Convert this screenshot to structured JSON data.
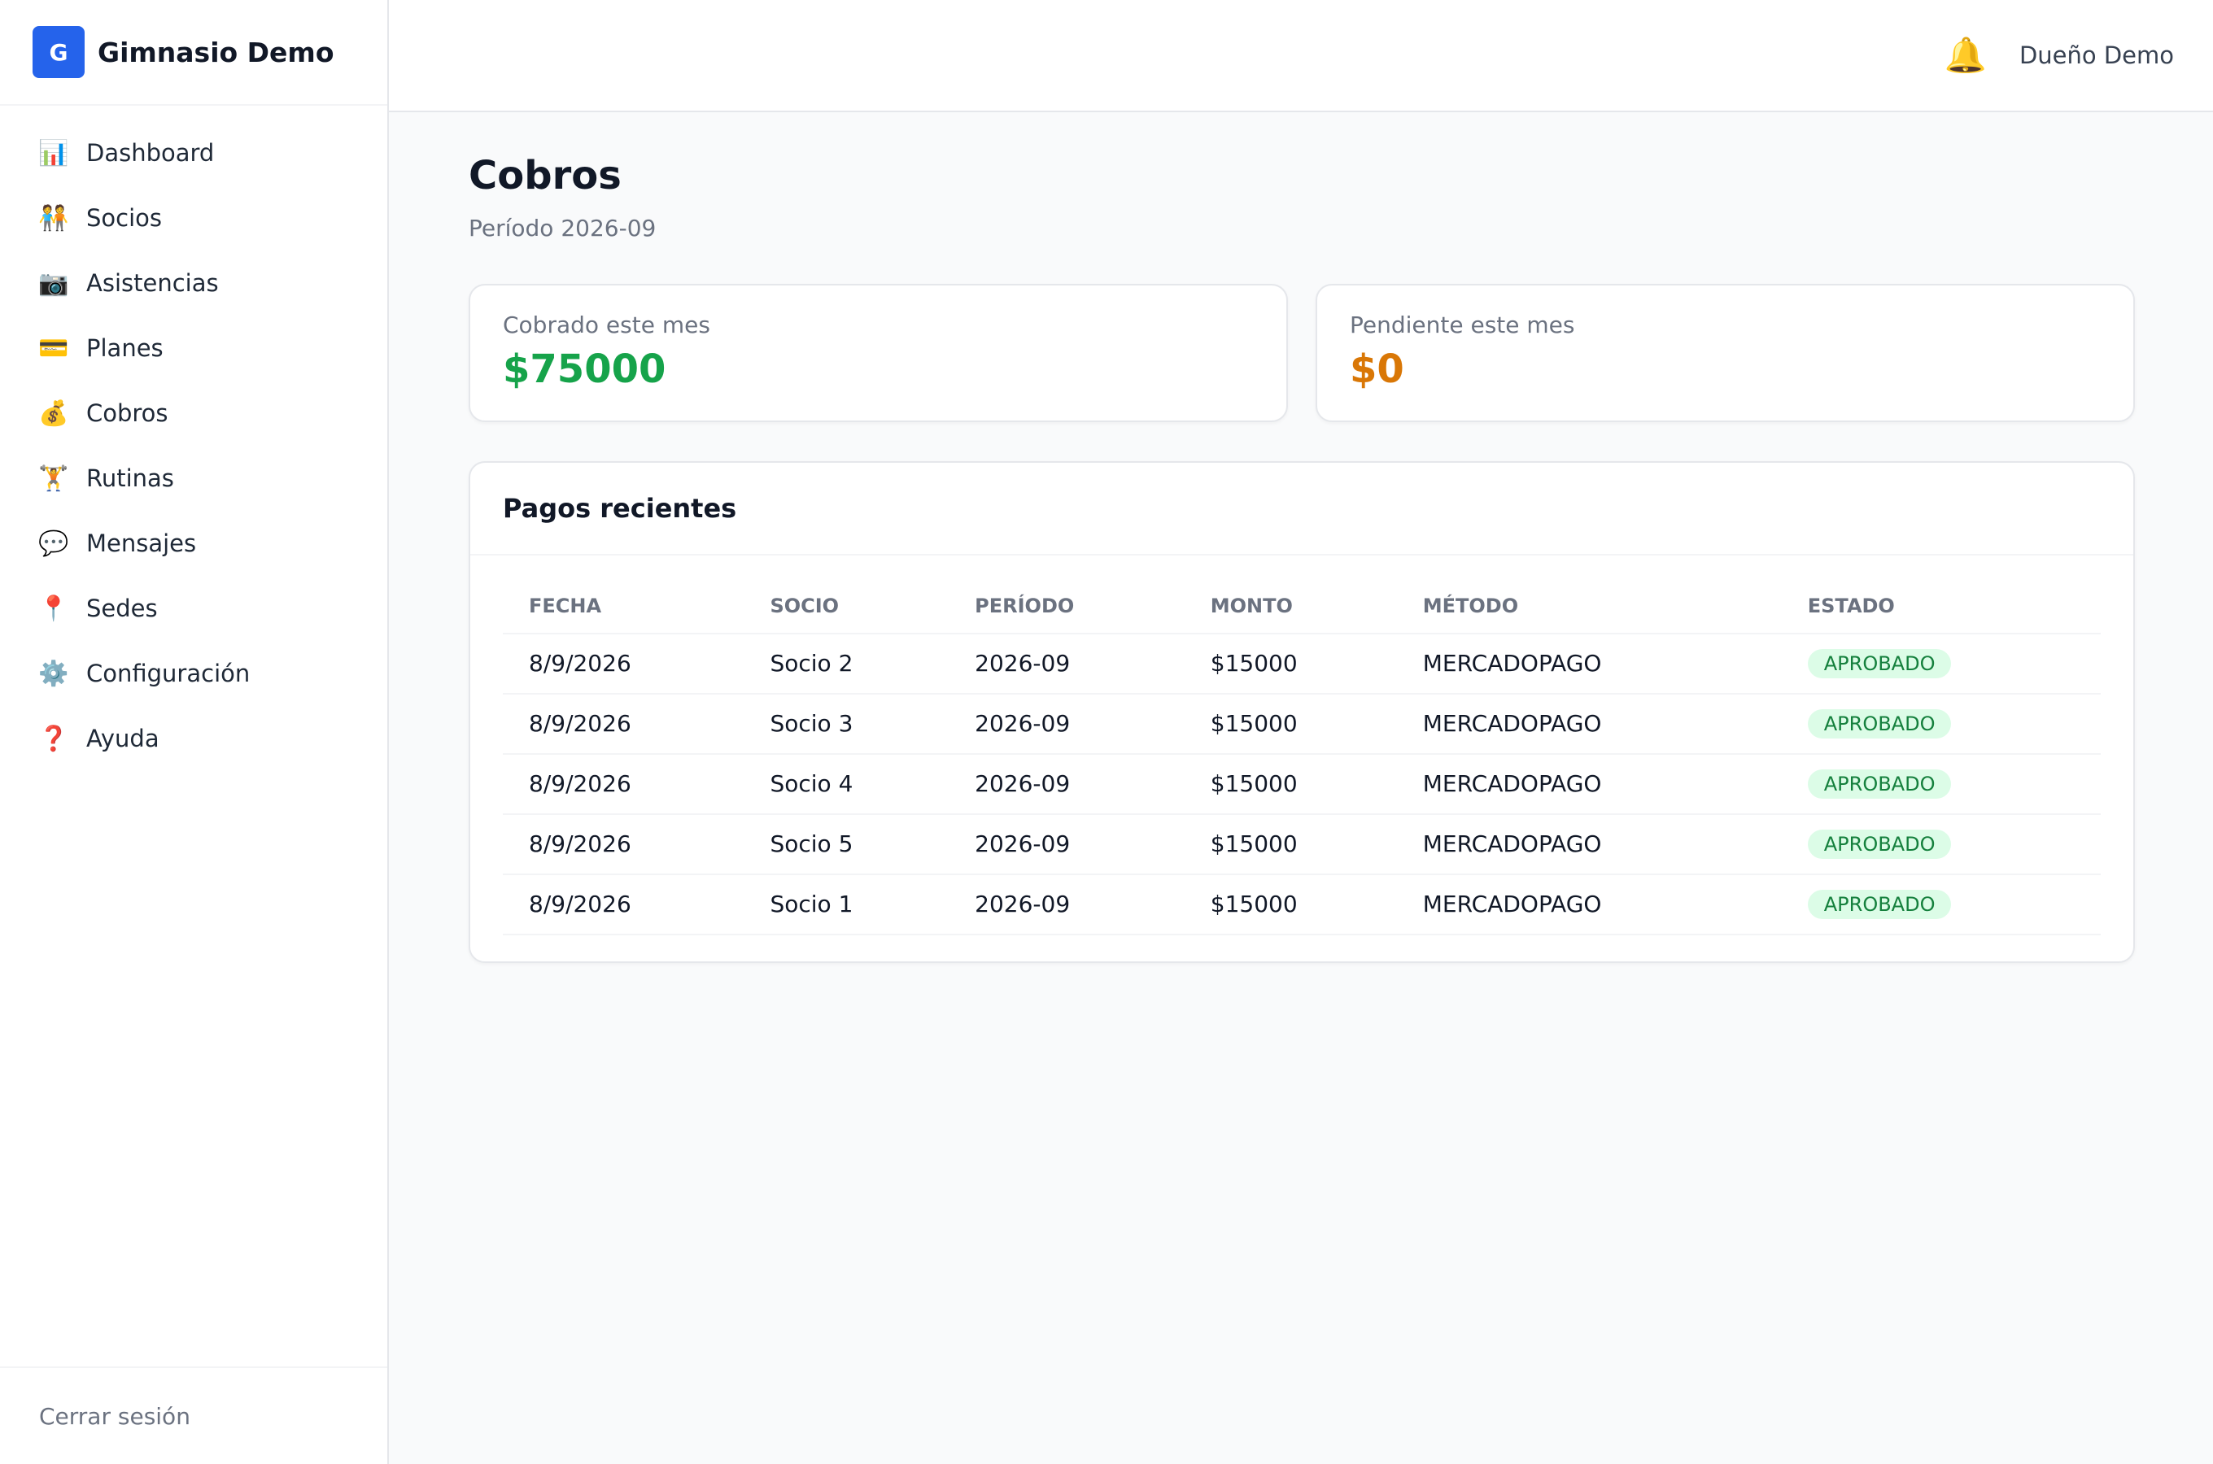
{
  "brand": {
    "logo_letter": "G",
    "name": "Gimnasio Demo"
  },
  "nav": [
    {
      "icon": "📊",
      "icon_name": "chart-icon",
      "label": "Dashboard"
    },
    {
      "icon": "🧑‍🤝‍🧑",
      "icon_name": "people-icon",
      "label": "Socios"
    },
    {
      "icon": "📷",
      "icon_name": "camera-icon",
      "label": "Asistencias"
    },
    {
      "icon": "💳",
      "icon_name": "credit-card-icon",
      "label": "Planes"
    },
    {
      "icon": "💰",
      "icon_name": "money-bag-icon",
      "label": "Cobros"
    },
    {
      "icon": "🏋️",
      "icon_name": "weightlifter-icon",
      "label": "Rutinas"
    },
    {
      "icon": "💬",
      "icon_name": "speech-bubble-icon",
      "label": "Mensajes"
    },
    {
      "icon": "📍",
      "icon_name": "pin-icon",
      "label": "Sedes"
    },
    {
      "icon": "⚙️",
      "icon_name": "gear-icon",
      "label": "Configuración"
    },
    {
      "icon": "❓",
      "icon_name": "question-icon",
      "label": "Ayuda"
    }
  ],
  "logout_label": "Cerrar sesión",
  "topbar": {
    "bell_icon": "🔔",
    "user_name": "Dueño Demo"
  },
  "page": {
    "title": "Cobros",
    "subtitle": "Período 2026-09"
  },
  "stats": {
    "collected": {
      "label": "Cobrado este mes",
      "value": "$75000",
      "color": "#16a34a"
    },
    "pending": {
      "label": "Pendiente este mes",
      "value": "$0",
      "color": "#d97706"
    }
  },
  "payments": {
    "title": "Pagos recientes",
    "columns": [
      "FECHA",
      "SOCIO",
      "PERÍODO",
      "MONTO",
      "MÉTODO",
      "ESTADO"
    ],
    "rows": [
      [
        "8/9/2026",
        "Socio 2",
        "2026-09",
        "$15000",
        "MERCADOPAGO",
        "APROBADO"
      ],
      [
        "8/9/2026",
        "Socio 3",
        "2026-09",
        "$15000",
        "MERCADOPAGO",
        "APROBADO"
      ],
      [
        "8/9/2026",
        "Socio 4",
        "2026-09",
        "$15000",
        "MERCADOPAGO",
        "APROBADO"
      ],
      [
        "8/9/2026",
        "Socio 5",
        "2026-09",
        "$15000",
        "MERCADOPAGO",
        "APROBADO"
      ],
      [
        "8/9/2026",
        "Socio 1",
        "2026-09",
        "$15000",
        "MERCADOPAGO",
        "APROBADO"
      ]
    ]
  }
}
